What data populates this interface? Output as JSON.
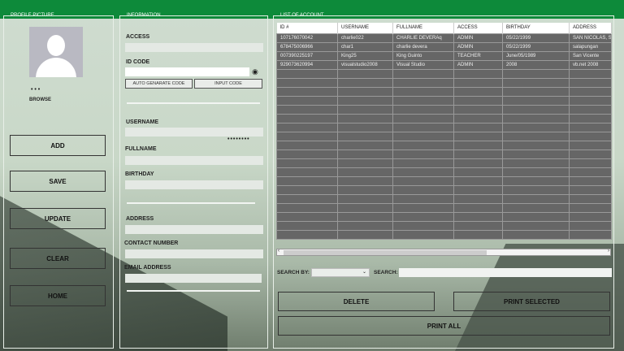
{
  "profile": {
    "title": "PROFILE PICTURE",
    "dots": "• • •",
    "browse": "BROWSE"
  },
  "actions": [
    "ADD",
    "SAVE",
    "UPDATE",
    "CLEAR",
    "HOME"
  ],
  "info": {
    "title": "INFORMATION",
    "access": "ACCESS",
    "id_code": "ID CODE",
    "auto_gen": "AUTO GENARATE CODE",
    "input_code": "INPUT CODE",
    "username": "USERNAME",
    "password_mask": "••••••••",
    "fullname": "FULLNAME",
    "birthday": "BIRTHDAY",
    "address": "ADDRESS",
    "contact": "CONTACT NUMBER",
    "email": "EMAIL ADDRESS"
  },
  "list": {
    "title": "LIST OF ACCOUNT",
    "columns": [
      "ID #",
      "USERNAME",
      "FULLNAME",
      "ACCESS",
      "BIRTHDAY",
      "ADDRESS"
    ],
    "rows": [
      [
        "107176070042",
        "charlie022",
        "CHARLIE DEVERAq",
        "ADMIN",
        "05/22/1999",
        "SAN NICOLAS, SAN"
      ],
      [
        "678475006966",
        "char1",
        "charlie devera",
        "ADMIN",
        "05/22/1999",
        "salapungan"
      ],
      [
        "007390225197",
        "King25",
        "King Guinto",
        "TEACHER",
        "June/05/1989",
        "San Vicente"
      ],
      [
        "929073620994",
        "visualstudio2008",
        "Visual Studio",
        "ADMIN",
        "2008",
        "vb.net 2008"
      ]
    ]
  },
  "search": {
    "by_label": "SEARCH BY:",
    "search_label": "SEARCH:",
    "by_value": "",
    "query": ""
  },
  "buttons": {
    "delete": "DELETE",
    "print_selected": "PRINT SELECTED",
    "print_all": "PRINT ALL"
  }
}
